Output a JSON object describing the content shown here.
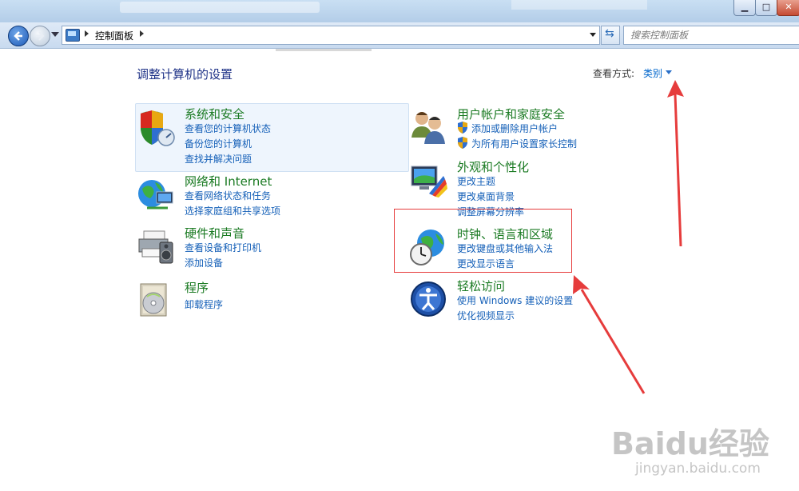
{
  "address_bar": {
    "breadcrumb": "控制面板"
  },
  "search": {
    "placeholder": "搜索控制面板"
  },
  "page": {
    "title": "调整计算机的设置",
    "view_label": "查看方式:",
    "view_value": "类别"
  },
  "categories_left": [
    {
      "title": "系统和安全",
      "icon": "shield-icon",
      "links": [
        "查看您的计算机状态",
        "备份您的计算机",
        "查找并解决问题"
      ]
    },
    {
      "title": "网络和 Internet",
      "icon": "network-globe-icon",
      "links": [
        "查看网络状态和任务",
        "选择家庭组和共享选项"
      ]
    },
    {
      "title": "硬件和声音",
      "icon": "printer-speaker-icon",
      "links": [
        "查看设备和打印机",
        "添加设备"
      ]
    },
    {
      "title": "程序",
      "icon": "programs-disc-icon",
      "links": [
        "卸载程序"
      ]
    }
  ],
  "categories_right": [
    {
      "title": "用户帐户和家庭安全",
      "icon": "users-icon",
      "links": [
        "添加或删除用户帐户",
        "为所有用户设置家长控制"
      ]
    },
    {
      "title": "外观和个性化",
      "icon": "appearance-monitor-icon",
      "links": [
        "更改主题",
        "更改桌面背景",
        "调整屏幕分辨率"
      ]
    },
    {
      "title": "时钟、语言和区域",
      "icon": "clock-globe-icon",
      "links": [
        "更改键盘或其他输入法",
        "更改显示语言"
      ]
    },
    {
      "title": "轻松访问",
      "icon": "ease-of-access-icon",
      "links": [
        "使用 Windows 建议的设置",
        "优化视频显示"
      ]
    }
  ],
  "watermark": {
    "logo": "Baidu经验",
    "url": "jingyan.baidu.com"
  },
  "colors": {
    "title_blue": "#1e3287",
    "category_green": "#1a7a22",
    "link_blue": "#1560b8",
    "annotation_red": "#e63c3c"
  }
}
